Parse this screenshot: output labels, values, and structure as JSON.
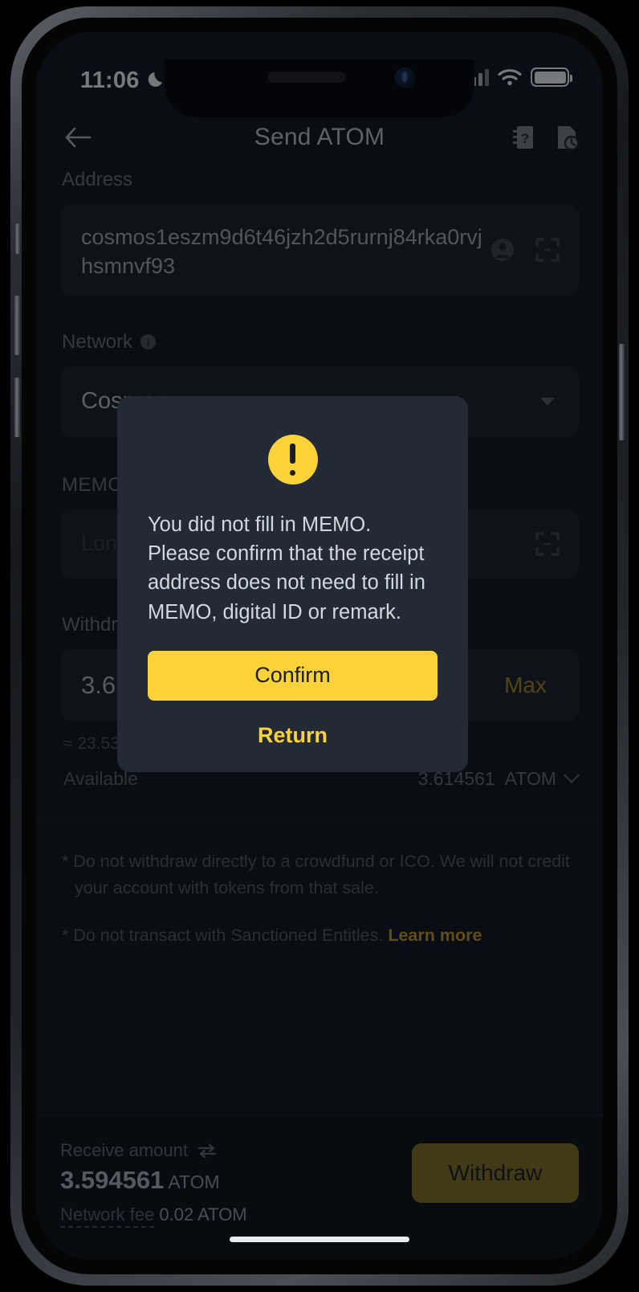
{
  "status_bar": {
    "time": "11:06",
    "moon_icon": "moon-icon",
    "signal_icon": "signal-bars-icon",
    "wifi_icon": "wifi-icon",
    "battery_icon": "battery-icon"
  },
  "app_bar": {
    "back_icon": "back-arrow-icon",
    "title": "Send ATOM",
    "action_1_icon": "address-book-icon",
    "action_2_icon": "transaction-history-icon"
  },
  "form": {
    "address": {
      "label": "Address",
      "value": "cosmos1eszm9d6t46jzh2d5rurnj84rka0rvjhsmnvf93",
      "contact_icon": "contact-icon",
      "scan_icon": "qr-scan-icon"
    },
    "network": {
      "label": "Network",
      "info_icon": "info-icon",
      "value": "Cosmos",
      "caret_icon": "chevron-down-icon"
    },
    "memo": {
      "label": "MEMO",
      "info_icon": "info-icon",
      "placeholder": "Long press to paste",
      "scan_icon": "qr-scan-icon"
    },
    "withdraw_amount": {
      "label": "Withdraw amount",
      "value": "3.614561",
      "max_label": "Max",
      "usd_equivalent": "≈ 23.53 USD",
      "available_label": "Available",
      "available_value": "3.614561",
      "available_unit": "ATOM",
      "chevron_icon": "chevron-down-icon"
    }
  },
  "notes": [
    {
      "text": "* Do not withdraw directly to a crowdfund or ICO. We will not credit your account with tokens from that sale.",
      "link": ""
    },
    {
      "text": "* Do not transact with Sanctioned Entitles. ",
      "link": "Learn more"
    }
  ],
  "bottom_bar": {
    "receive_label": "Receive amount",
    "swap_icon": "swap-arrows-icon",
    "receive_amount": "3.594561",
    "receive_unit": "ATOM",
    "fee_label": "Network fee",
    "fee_value": "0.02 ATOM",
    "withdraw_button": "Withdraw"
  },
  "modal": {
    "warning_icon": "warning-exclamation-icon",
    "message": "You did not fill in MEMO. Please confirm that the receipt address does not need to fill in MEMO, digital ID or remark.",
    "confirm_label": "Confirm",
    "return_label": "Return"
  },
  "colors": {
    "accent_yellow": "#FBD338",
    "accent_dim": "#8B7520",
    "link_yellow": "#C9A227",
    "page_bg": "#0F1319",
    "field_bg": "#181D26",
    "modal_bg": "#232A35"
  }
}
